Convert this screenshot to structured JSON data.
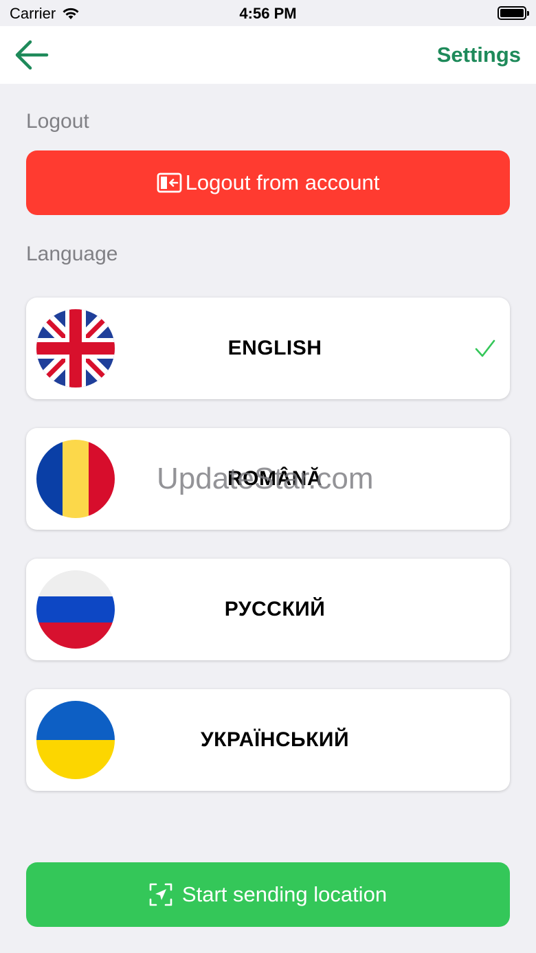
{
  "status_bar": {
    "carrier": "Carrier",
    "time": "4:56 PM"
  },
  "nav": {
    "title": "Settings",
    "back_icon": "arrow-left-icon",
    "accent_color": "#1e8a5a"
  },
  "logout_section": {
    "label": "Logout",
    "button_label": "Logout from account",
    "button_icon": "logout-icon",
    "button_color": "#ff3b30"
  },
  "language_section": {
    "label": "Language",
    "languages": [
      {
        "label": "ENGLISH",
        "flag": "uk-flag-icon",
        "selected": true
      },
      {
        "label": "ROMÂNĂ",
        "flag": "romania-flag-icon",
        "selected": false
      },
      {
        "label": "РУССКИЙ",
        "flag": "russia-flag-icon",
        "selected": false
      },
      {
        "label": "УКРАЇНСЬКИЙ",
        "flag": "ukraine-flag-icon",
        "selected": false
      }
    ],
    "check_color": "#34c759"
  },
  "watermark": "UpdateStar.com",
  "location_button": {
    "label": "Start sending location",
    "icon": "location-arrow-icon",
    "color": "#34c759"
  }
}
